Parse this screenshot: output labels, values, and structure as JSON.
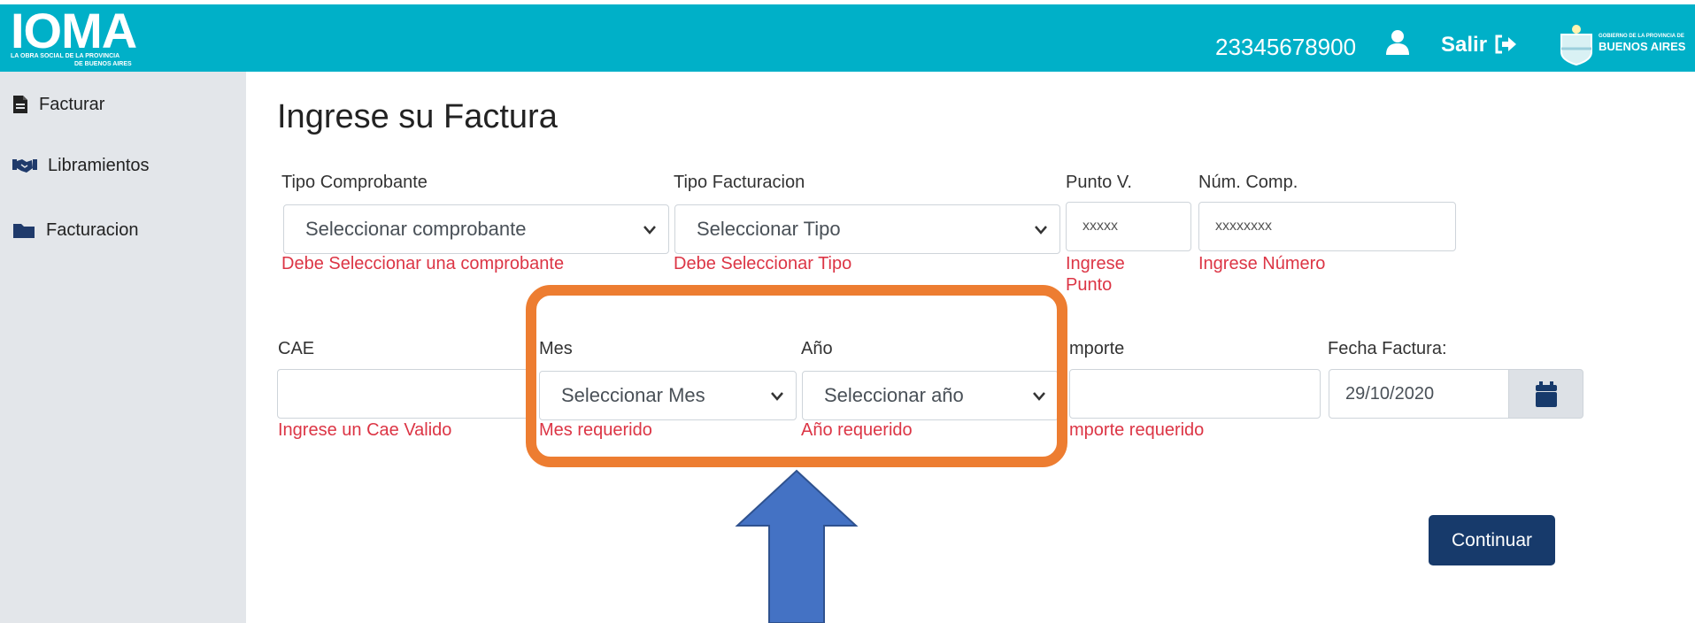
{
  "header": {
    "logo_text": "IOMA",
    "logo_subtitle_line1": "LA OBRA SOCIAL DE LA PROVINCIA",
    "logo_subtitle_line2": "DE BUENOS AIRES",
    "user_number": "23345678900",
    "logout_label": "Salir",
    "gov_logo_top": "GOBIERNO DE LA PROVINCIA DE",
    "gov_logo_main": "BUENOS AIRES",
    "background_color": "#00b0c8"
  },
  "sidebar": {
    "items": [
      {
        "label": "Facturar",
        "icon": "file-icon"
      },
      {
        "label": "Libramientos",
        "icon": "handshake-icon"
      },
      {
        "label": "Facturacion",
        "icon": "folder-icon"
      }
    ]
  },
  "page": {
    "title": "Ingrese su Factura"
  },
  "form": {
    "tipo_comprobante": {
      "label": "Tipo Comprobante",
      "value": "Seleccionar comprobante",
      "error": "Debe Seleccionar una comprobante"
    },
    "tipo_facturacion": {
      "label": "Tipo Facturacion",
      "value": "Seleccionar Tipo",
      "error": "Debe Seleccionar Tipo"
    },
    "punto_venta": {
      "label": "Punto V.",
      "placeholder": "xxxxx",
      "error_line1": "Ingrese",
      "error_line2": "Punto"
    },
    "num_comp": {
      "label": "Núm. Comp.",
      "placeholder": "xxxxxxxx",
      "error": "Ingrese Número"
    },
    "cae": {
      "label": "CAE",
      "value": "",
      "error": "Ingrese un Cae Valido"
    },
    "mes": {
      "label": "Mes",
      "value": "Seleccionar Mes",
      "error": "Mes requerido"
    },
    "anio": {
      "label": "Año",
      "value": "Seleccionar año",
      "error": "Año requerido"
    },
    "importe": {
      "label": "mporte",
      "value": "",
      "error": "mporte requerido"
    },
    "fecha_factura": {
      "label": "Fecha Factura:",
      "value": "29/10/2020"
    },
    "continue_label": "Continuar"
  },
  "annotation": {
    "highlight_color": "#ed7d31",
    "arrow_color": "#4472c4"
  }
}
